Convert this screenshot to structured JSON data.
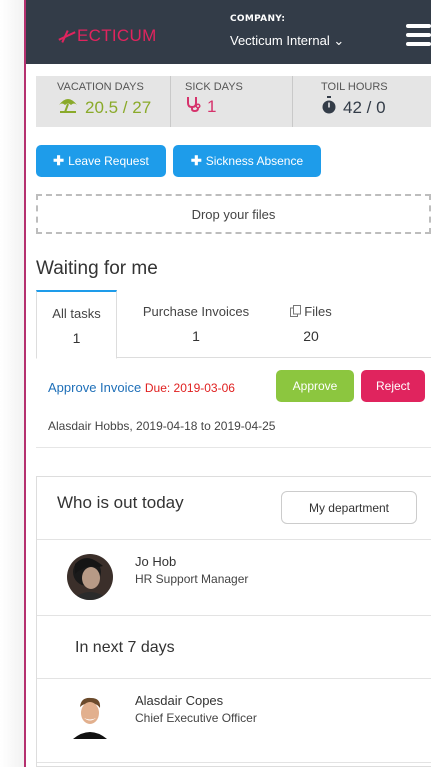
{
  "header": {
    "logo_text": "ECTICUM",
    "company_label": "COMPANY:",
    "company_value": "Vecticum Internal",
    "company_caret": "⌄"
  },
  "stats": [
    {
      "label": "VACATION DAYS",
      "value": "20.5 / 27",
      "icon": "beach-umbrella-icon"
    },
    {
      "label": "SICK DAYS",
      "value": "1",
      "icon": "stethoscope-icon"
    },
    {
      "label": "TOIL HOURS",
      "value": "42 / 0",
      "icon": "stopwatch-icon"
    }
  ],
  "actions": {
    "leave_request": "Leave Request",
    "sickness_absence": "Sickness Absence",
    "plus_glyph": "✚"
  },
  "dropzone": {
    "label": "Drop your files"
  },
  "waiting": {
    "title": "Waiting for me",
    "tabs": [
      {
        "label": "All tasks",
        "count": "1"
      },
      {
        "label": "Purchase Invoices",
        "count": "1"
      },
      {
        "label": "Files",
        "count": "20",
        "icon": "files-icon"
      }
    ],
    "task": {
      "title": "Approve Invoice",
      "due": "Due: 2019-03-06",
      "approve_label": "Approve",
      "reject_label": "Reject",
      "subtitle": "Alasdair Hobbs, 2019-04-18 to 2019-04-25"
    }
  },
  "out_today": {
    "title": "Who is out today",
    "filter_label": "My department",
    "people": [
      {
        "name": "Jo Hob",
        "role": "HR Support Manager"
      }
    ],
    "next_title": "In next 7 days",
    "next_people": [
      {
        "name": "Alasdair Copes",
        "role": "Chief Executive Officer"
      }
    ]
  },
  "colors": {
    "header_bg": "#333c48",
    "brand": "#e0245e",
    "primary": "#1e9cea",
    "approve": "#8cc63f",
    "reject": "#e0245e",
    "vacation": "#8aaa2a"
  }
}
